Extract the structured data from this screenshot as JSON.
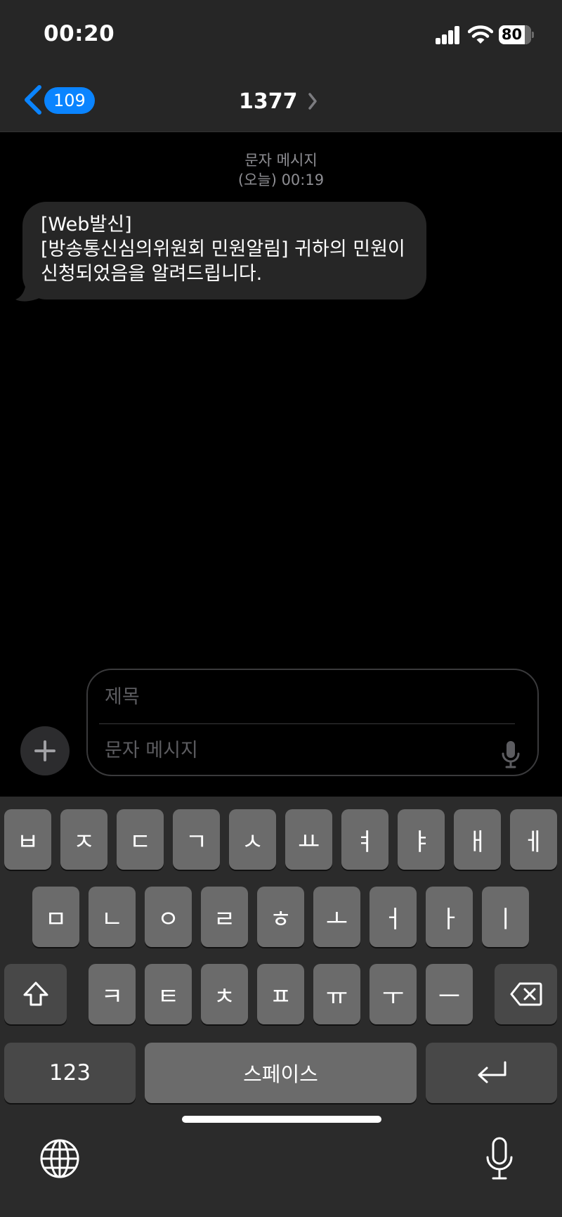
{
  "status_bar": {
    "time": "00:20",
    "battery": "80"
  },
  "nav": {
    "back_count": "109",
    "contact": "1377"
  },
  "conversation": {
    "meta_type": "문자 메시지",
    "meta_time": "(오늘) 00:19",
    "message_lines": [
      "[Web발신]",
      "[방송통신심의위원회 민원알림] 귀하의 민원이",
      "신청되었음을 알려드립니다."
    ]
  },
  "composer": {
    "subject_placeholder": "제목",
    "message_placeholder": "문자 메시지"
  },
  "keyboard": {
    "row1": [
      "ㅂ",
      "ㅈ",
      "ㄷ",
      "ㄱ",
      "ㅅ",
      "ㅛ",
      "ㅕ",
      "ㅑ",
      "ㅐ",
      "ㅔ"
    ],
    "row2": [
      "ㅁ",
      "ㄴ",
      "ㅇ",
      "ㄹ",
      "ㅎ",
      "ㅗ",
      "ㅓ",
      "ㅏ",
      "ㅣ"
    ],
    "row3": [
      "ㅋ",
      "ㅌ",
      "ㅊ",
      "ㅍ",
      "ㅠ",
      "ㅜ",
      "ㅡ"
    ],
    "numbers_label": "123",
    "space_label": "스페이스"
  },
  "colors": {
    "accent": "#0a84ff",
    "bubble": "#262626",
    "key": "#6b6b6b",
    "key_dark": "#484848"
  }
}
